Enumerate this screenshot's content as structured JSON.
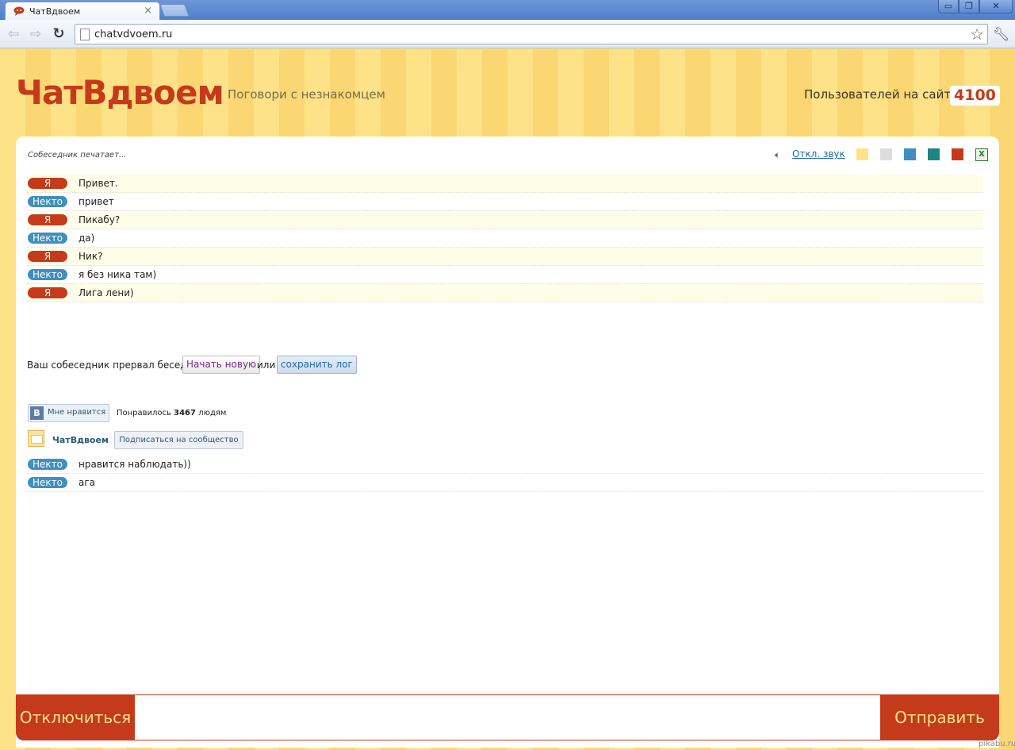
{
  "browser": {
    "tab_title": "ЧатВдвоем",
    "url": "chatvdvoem.ru",
    "window_buttons": {
      "minimize": "▭",
      "maximize": "❐",
      "close": "✕"
    }
  },
  "header": {
    "logo": "ЧатВдвоем",
    "slogan": "Поговори с незнакомцем",
    "users_label": "Пользователей на сайте",
    "users_count": "4100"
  },
  "status": {
    "typing": "Собеседник печатает...",
    "sound_toggle": "Откл. звук",
    "theme_colors": [
      "#fde288",
      "#dddddd",
      "#3f8fc0",
      "#1f8580",
      "#c53a1b"
    ]
  },
  "labels": {
    "me": "Я",
    "stranger": "Некто"
  },
  "messages": [
    {
      "from": "me",
      "author": "Я",
      "text": "Привет."
    },
    {
      "from": "stranger",
      "author": "Некто",
      "text": "привет"
    },
    {
      "from": "me",
      "author": "Я",
      "text": "Пикабу?"
    },
    {
      "from": "stranger",
      "author": "Некто",
      "text": "да)"
    },
    {
      "from": "me",
      "author": "Я",
      "text": "Ник?"
    },
    {
      "from": "stranger",
      "author": "Некто",
      "text": "я без ника там)"
    },
    {
      "from": "me",
      "author": "Я",
      "text": "Лига лени)"
    }
  ],
  "ended": {
    "text": "Ваш собеседник прервал беседу.",
    "new_chat": "Начать новую",
    "or": "или",
    "save_log": "сохранить лог"
  },
  "vk": {
    "badge": "В",
    "like_button": "Мне нравится",
    "likes_prefix": "Понравилось",
    "likes_count": "3467",
    "likes_suffix": "людям",
    "group_name": "ЧатВдвоем",
    "subscribe": "Подписаться на сообщество"
  },
  "messages_after": [
    {
      "from": "stranger",
      "author": "Некто",
      "text": "нравится наблюдать))"
    },
    {
      "from": "stranger",
      "author": "Некто",
      "text": "ага"
    }
  ],
  "controls": {
    "disconnect": "Отключиться",
    "send": "Отправить",
    "input_value": ""
  },
  "watermark": "pikabu.ru"
}
